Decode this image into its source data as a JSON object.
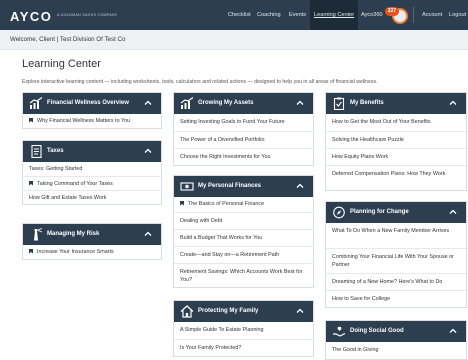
{
  "header": {
    "logo": "AYCO",
    "logo_sub": "A GOLDMAN SACHS COMPANY",
    "nav": [
      "Checklist",
      "Coaching",
      "Events",
      "Learning Center",
      "Ayco360",
      "Account",
      "Logout"
    ],
    "active_nav": "Learning Center",
    "notification_count": "227"
  },
  "welcome": "Welcome, Client | Test Division Of Test Co",
  "page": {
    "title": "Learning Center",
    "intro": "Explore interactive learning content — including worksheets, tools, calculators and related actions — designed to help you in all areas of financial wellness."
  },
  "colors": {
    "header": "#2c3e50",
    "accent": "#f07c2d"
  },
  "cards": {
    "financial_wellness": {
      "icon": "chart-growth-icon",
      "title": "Financial Wellness Overview",
      "items": [
        "Why Financial Wellness Matters to You"
      ]
    },
    "taxes": {
      "icon": "document-icon",
      "title": "Taxes",
      "items": [
        "Taxes: Getting Started",
        "Taking Command of Your Taxes",
        "How Gift and Estate Taxes Work"
      ]
    },
    "managing_risk": {
      "icon": "lighthouse-icon",
      "title": "Managing My Risk",
      "items": [
        "Increase Your Insurance Smarts"
      ]
    },
    "growing_assets": {
      "icon": "chart-growth-icon",
      "title": "Growing My Assets",
      "items": [
        "Setting Investing Goals to Fund Your Future",
        "The Power of a Diversified Portfolio",
        "Choose the Right Investments for You"
      ]
    },
    "personal_finances": {
      "icon": "money-icon",
      "title": "My Personal Finances",
      "items": [
        "The Basics of Personal Finance",
        "Dealing with Debt",
        "Build a Budget That Works for You",
        "Create—and Stay on—a Retirement Path",
        "Retirement Savings: Which Accounts Work Best for You?"
      ]
    },
    "protecting_family": {
      "icon": "home-icon",
      "title": "Protecting My Family",
      "items": [
        "A Simple Guide To Estate Planning",
        "Is Your Family Protected?"
      ]
    },
    "my_benefits": {
      "icon": "clipboard-icon",
      "title": "My Benefits",
      "items": [
        "How to Get the Most Out of Your Benefits",
        "Solving the Healthcare Puzzle",
        "How Equity Plans Work",
        "Deferred Compensation Plans: How They Work"
      ]
    },
    "planning_change": {
      "icon": "compass-icon",
      "title": "Planning for Change",
      "items": [
        "What To Do When a New Family Member Arrives",
        "Combining Your Financial Life With Your Spouse or Partner",
        "Dreaming of a New Home? Here's What to Do",
        "How to Save for College"
      ]
    },
    "social_good": {
      "icon": "giving-hand-icon",
      "title": "Doing Social Good",
      "items": [
        "The Good in Giving"
      ]
    }
  }
}
